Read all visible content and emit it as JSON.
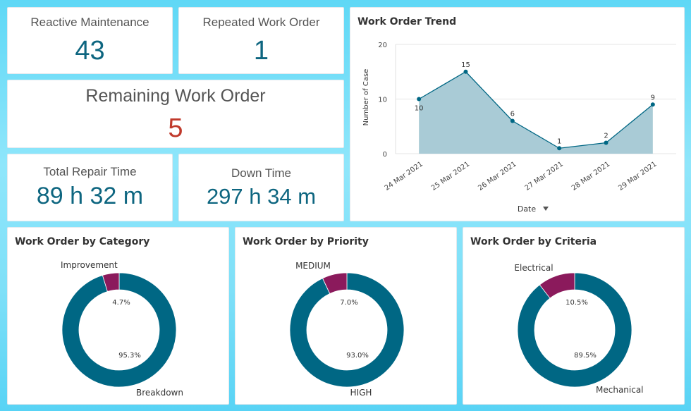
{
  "colors": {
    "primary": "#006784",
    "secondary": "#8b1a5c",
    "area_fill": "#a9cbd6",
    "value_teal": "#0e6680",
    "value_red": "#c0392b"
  },
  "kpis": {
    "reactive_maintenance": {
      "label": "Reactive Maintenance",
      "value": "43"
    },
    "repeated_work_order": {
      "label": "Repeated Work Order",
      "value": "1"
    },
    "remaining_work_order": {
      "label": "Remaining Work Order",
      "value": "5"
    },
    "total_repair_time": {
      "label": "Total Repair Time",
      "value": "89 h 32 m"
    },
    "down_time": {
      "label": "Down Time",
      "value": "297 h 34 m"
    }
  },
  "trend": {
    "title": "Work Order Trend",
    "sort_icon": "triangle-down-icon"
  },
  "donuts": {
    "category": {
      "title": "Work Order by Category"
    },
    "priority": {
      "title": "Work Order by Priority"
    },
    "criteria": {
      "title": "Work Order by Criteria"
    }
  },
  "chart_data": [
    {
      "type": "area",
      "title": "Work Order Trend",
      "xlabel": "Date",
      "ylabel": "Number of Case",
      "categories": [
        "24 Mar 2021",
        "25 Mar 2021",
        "26 Mar 2021",
        "27 Mar 2021",
        "28 Mar 2021",
        "29 Mar 2021"
      ],
      "values": [
        10,
        15,
        6,
        1,
        2,
        9
      ],
      "ylim": [
        0,
        20
      ],
      "yticks": [
        "0",
        "10",
        "20"
      ],
      "grid": true
    },
    {
      "type": "pie",
      "title": "Work Order by Category",
      "slices": [
        {
          "label": "Breakdown",
          "value": 95.3,
          "display": "95.3%"
        },
        {
          "label": "Improvement",
          "value": 4.7,
          "display": "4.7%"
        }
      ]
    },
    {
      "type": "pie",
      "title": "Work Order by Priority",
      "slices": [
        {
          "label": "HIGH",
          "value": 93.0,
          "display": "93.0%"
        },
        {
          "label": "MEDIUM",
          "value": 7.0,
          "display": "7.0%"
        }
      ]
    },
    {
      "type": "pie",
      "title": "Work Order by Criteria",
      "slices": [
        {
          "label": "Mechanical",
          "value": 89.5,
          "display": "89.5%"
        },
        {
          "label": "Electrical",
          "value": 10.5,
          "display": "10.5%"
        }
      ]
    }
  ]
}
